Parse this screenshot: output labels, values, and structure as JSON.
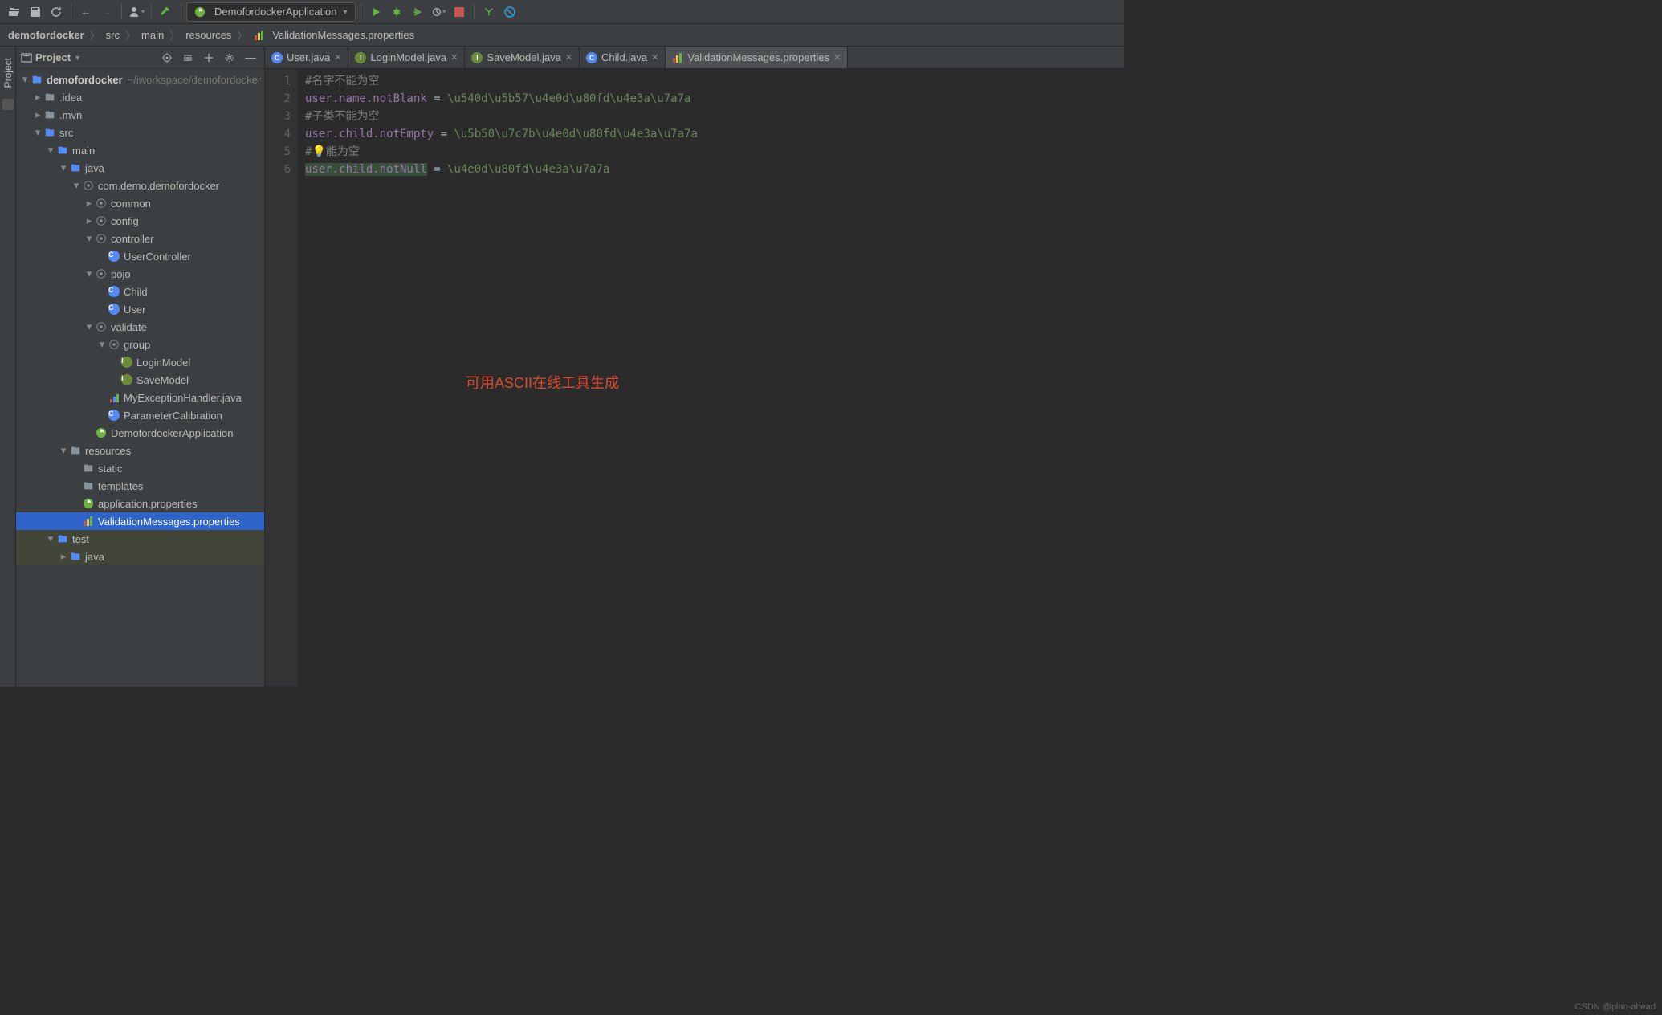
{
  "run_config": "DemofordockerApplication",
  "breadcrumb": [
    "demofordocker",
    "src",
    "main",
    "resources",
    "ValidationMessages.properties"
  ],
  "project_panel": {
    "title": "Project"
  },
  "tree": {
    "root": {
      "name": "demofordocker",
      "path": "~/iworkspace/demofordocker"
    },
    "items": [
      {
        "d": 1,
        "tw": "▸",
        "type": "folder",
        "label": ".idea"
      },
      {
        "d": 1,
        "tw": "▸",
        "type": "folder",
        "label": ".mvn"
      },
      {
        "d": 1,
        "tw": "▾",
        "type": "folder-blue",
        "label": "src"
      },
      {
        "d": 2,
        "tw": "▾",
        "type": "folder-blue",
        "label": "main"
      },
      {
        "d": 3,
        "tw": "▾",
        "type": "folder-blue",
        "label": "java"
      },
      {
        "d": 4,
        "tw": "▾",
        "type": "pkg",
        "label": "com.demo.demofordocker"
      },
      {
        "d": 5,
        "tw": "▸",
        "type": "pkg",
        "label": "common"
      },
      {
        "d": 5,
        "tw": "▸",
        "type": "pkg",
        "label": "config"
      },
      {
        "d": 5,
        "tw": "▾",
        "type": "pkg",
        "label": "controller"
      },
      {
        "d": 6,
        "tw": "",
        "type": "class",
        "label": "UserController"
      },
      {
        "d": 5,
        "tw": "▾",
        "type": "pkg",
        "label": "pojo"
      },
      {
        "d": 6,
        "tw": "",
        "type": "class",
        "label": "Child"
      },
      {
        "d": 6,
        "tw": "",
        "type": "class",
        "label": "User"
      },
      {
        "d": 5,
        "tw": "▾",
        "type": "pkg",
        "label": "validate"
      },
      {
        "d": 6,
        "tw": "▾",
        "type": "pkg",
        "label": "group"
      },
      {
        "d": 7,
        "tw": "",
        "type": "interface",
        "label": "LoginModel"
      },
      {
        "d": 7,
        "tw": "",
        "type": "interface",
        "label": "SaveModel"
      },
      {
        "d": 6,
        "tw": "",
        "type": "java",
        "label": "MyExceptionHandler.java"
      },
      {
        "d": 6,
        "tw": "",
        "type": "class",
        "label": "ParameterCalibration"
      },
      {
        "d": 5,
        "tw": "",
        "type": "spring",
        "label": "DemofordockerApplication"
      },
      {
        "d": 3,
        "tw": "▾",
        "type": "folder-res",
        "label": "resources"
      },
      {
        "d": 4,
        "tw": "",
        "type": "folder",
        "label": "static"
      },
      {
        "d": 4,
        "tw": "",
        "type": "folder",
        "label": "templates"
      },
      {
        "d": 4,
        "tw": "",
        "type": "spring-prop",
        "label": "application.properties"
      },
      {
        "d": 4,
        "tw": "",
        "type": "prop",
        "label": "ValidationMessages.properties",
        "selected": true
      },
      {
        "d": 2,
        "tw": "▾",
        "type": "folder-blue",
        "label": "test",
        "dim": true
      },
      {
        "d": 3,
        "tw": "▸",
        "type": "folder-blue",
        "label": "java",
        "dim": true
      }
    ]
  },
  "tabs": [
    {
      "icon": "class",
      "label": "User.java"
    },
    {
      "icon": "interface",
      "label": "LoginModel.java"
    },
    {
      "icon": "interface",
      "label": "SaveModel.java"
    },
    {
      "icon": "class",
      "label": "Child.java"
    },
    {
      "icon": "prop",
      "label": "ValidationMessages.properties",
      "active": true
    }
  ],
  "code": {
    "lines": [
      {
        "n": 1,
        "type": "comment",
        "text": "#名字不能为空"
      },
      {
        "n": 2,
        "type": "kv",
        "key": "user.name.notBlank",
        "eq": " = ",
        "val": "\\u540d\\u5b57\\u4e0d\\u80fd\\u4e3a\\u7a7a"
      },
      {
        "n": 3,
        "type": "comment",
        "text": "#子类不能为空"
      },
      {
        "n": 4,
        "type": "kv",
        "key": "user.child.notEmpty",
        "eq": " = ",
        "val": "\\u5b50\\u7c7b\\u4e0d\\u80fd\\u4e3a\\u7a7a"
      },
      {
        "n": 5,
        "type": "comment-bulb",
        "pre": "#",
        "post": "能为空"
      },
      {
        "n": 6,
        "type": "kv-hl",
        "key": "user.child.notNull",
        "eq": " = ",
        "val": "\\u4e0d\\u80fd\\u4e3a\\u7a7a"
      }
    ]
  },
  "overlay": "可用ASCII在线工具生成",
  "watermark": "CSDN @plan-ahead"
}
